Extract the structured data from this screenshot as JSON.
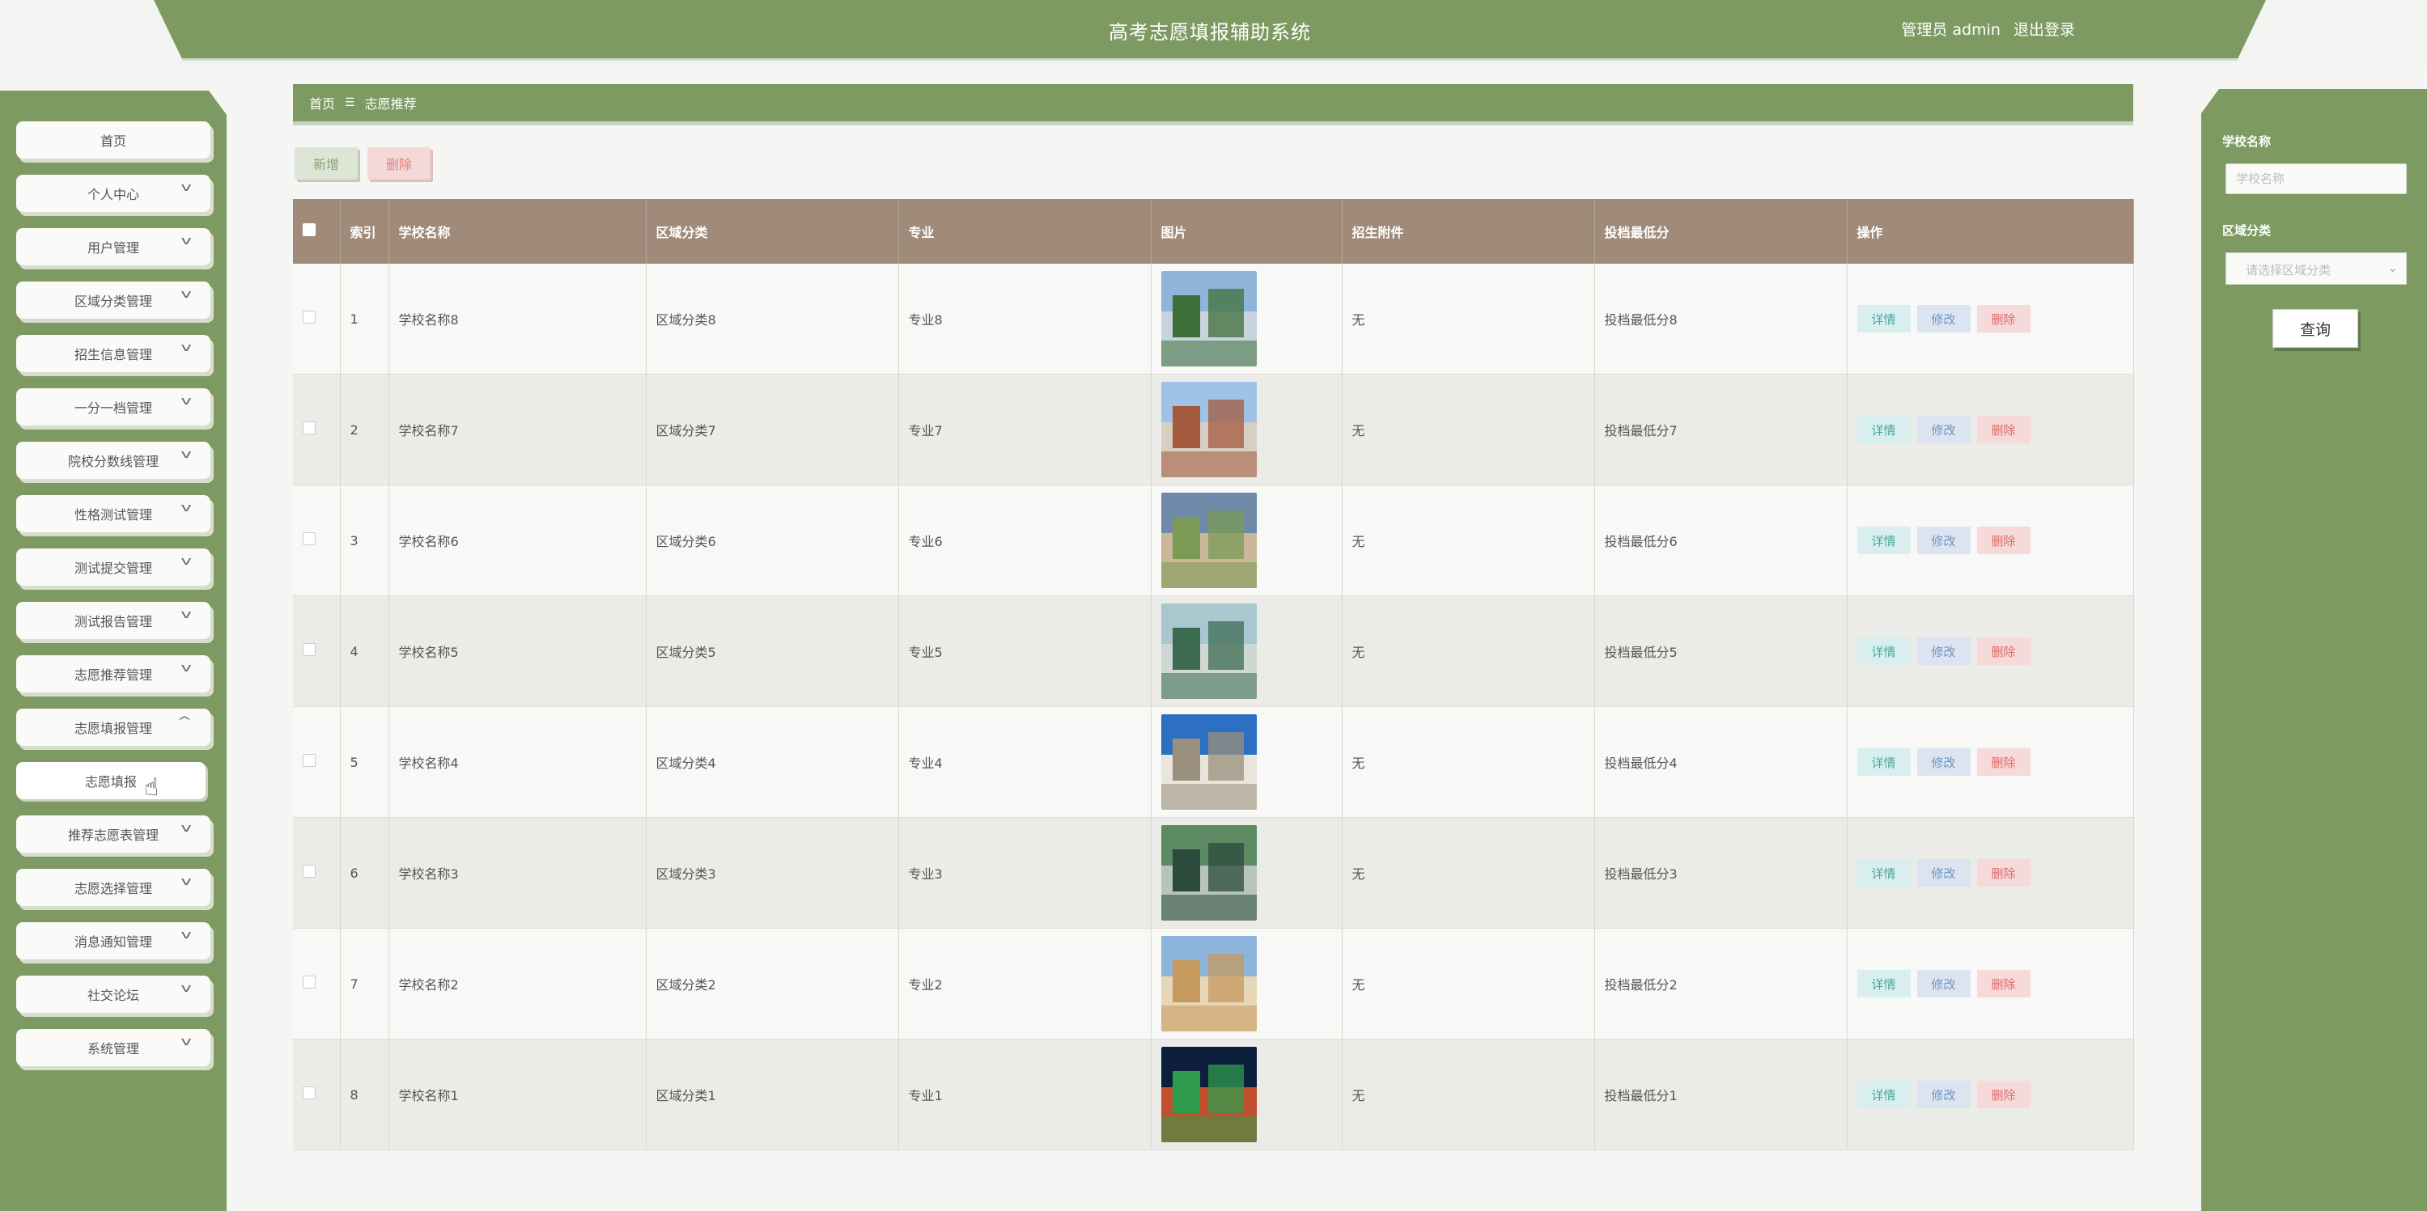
{
  "header": {
    "title": "高考志愿填报辅助系统",
    "user_role": "管理员",
    "user_name": "admin",
    "logout": "退出登录"
  },
  "sidebar": {
    "items": [
      {
        "label": "首页",
        "chevron": false
      },
      {
        "label": "个人中心",
        "chevron": true
      },
      {
        "label": "用户管理",
        "chevron": true
      },
      {
        "label": "区域分类管理",
        "chevron": true
      },
      {
        "label": "招生信息管理",
        "chevron": true
      },
      {
        "label": "一分一档管理",
        "chevron": true
      },
      {
        "label": "院校分数线管理",
        "chevron": true
      },
      {
        "label": "性格测试管理",
        "chevron": true
      },
      {
        "label": "测试提交管理",
        "chevron": true
      },
      {
        "label": "测试报告管理",
        "chevron": true
      },
      {
        "label": "志愿推荐管理",
        "chevron": true
      },
      {
        "label": "志愿填报管理",
        "chevron": true
      },
      {
        "label": "志愿填报",
        "chevron": false
      },
      {
        "label": "推荐志愿表管理",
        "chevron": true
      },
      {
        "label": "志愿选择管理",
        "chevron": true
      },
      {
        "label": "消息通知管理",
        "chevron": true
      },
      {
        "label": "社交论坛",
        "chevron": true
      },
      {
        "label": "系统管理",
        "chevron": true
      }
    ]
  },
  "breadcrumb": {
    "home": "首页",
    "current": "志愿推荐"
  },
  "toolbar": {
    "add": "新增",
    "delete": "删除"
  },
  "table": {
    "headers": [
      "索引",
      "学校名称",
      "区域分类",
      "专业",
      "图片",
      "招生附件",
      "投档最低分",
      "操作"
    ],
    "actions": {
      "detail": "详情",
      "edit": "修改",
      "delete": "删除"
    },
    "rows": [
      {
        "index": "1",
        "school": "学校名称8",
        "region": "区域分类8",
        "major": "专业8",
        "attachment": "无",
        "min_score": "投档最低分8"
      },
      {
        "index": "2",
        "school": "学校名称7",
        "region": "区域分类7",
        "major": "专业7",
        "attachment": "无",
        "min_score": "投档最低分7"
      },
      {
        "index": "3",
        "school": "学校名称6",
        "region": "区域分类6",
        "major": "专业6",
        "attachment": "无",
        "min_score": "投档最低分6"
      },
      {
        "index": "4",
        "school": "学校名称5",
        "region": "区域分类5",
        "major": "专业5",
        "attachment": "无",
        "min_score": "投档最低分5"
      },
      {
        "index": "5",
        "school": "学校名称4",
        "region": "区域分类4",
        "major": "专业4",
        "attachment": "无",
        "min_score": "投档最低分4"
      },
      {
        "index": "6",
        "school": "学校名称3",
        "region": "区域分类3",
        "major": "专业3",
        "attachment": "无",
        "min_score": "投档最低分3"
      },
      {
        "index": "7",
        "school": "学校名称2",
        "region": "区域分类2",
        "major": "专业2",
        "attachment": "无",
        "min_score": "投档最低分2"
      },
      {
        "index": "8",
        "school": "学校名称1",
        "region": "区域分类1",
        "major": "专业1",
        "attachment": "无",
        "min_score": "投档最低分1"
      }
    ]
  },
  "search": {
    "school_label": "学校名称",
    "school_placeholder": "学校名称",
    "region_label": "区域分类",
    "region_placeholder": "请选择区域分类",
    "query_button": "查询"
  },
  "colors": {
    "brand_green": "#7d9a62",
    "table_header": "#a08b7b"
  }
}
